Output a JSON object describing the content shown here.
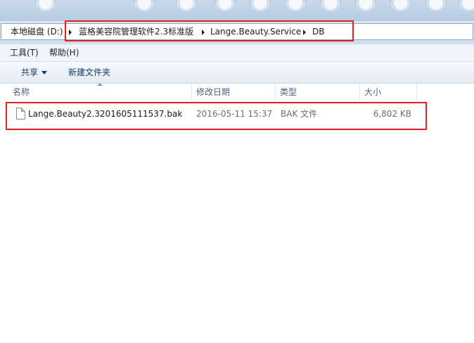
{
  "address": {
    "crumbs": [
      "本地磁盘 (D:)",
      "蓝格美容院管理软件2.3标准版",
      "Lange.Beauty.Service",
      "DB"
    ]
  },
  "menu": {
    "tools": "工具(T)",
    "help": "帮助(H)"
  },
  "toolbar": {
    "share": "共享",
    "new_folder": "新建文件夹"
  },
  "columns": {
    "name": "名称",
    "modified": "修改日期",
    "type": "类型",
    "size": "大小"
  },
  "files": [
    {
      "name": "Lange.Beauty2.3201605111537.bak",
      "modified": "2016-05-11 15:37",
      "type": "BAK 文件",
      "size": "6,802 KB"
    }
  ],
  "colors": {
    "highlight": "#e02020",
    "header_text": "#4c607a",
    "toolbar_text": "#1b3a61"
  },
  "icons": [
    "chevron-right-icon",
    "chevron-down-icon",
    "sort-up-icon",
    "file-icon"
  ]
}
